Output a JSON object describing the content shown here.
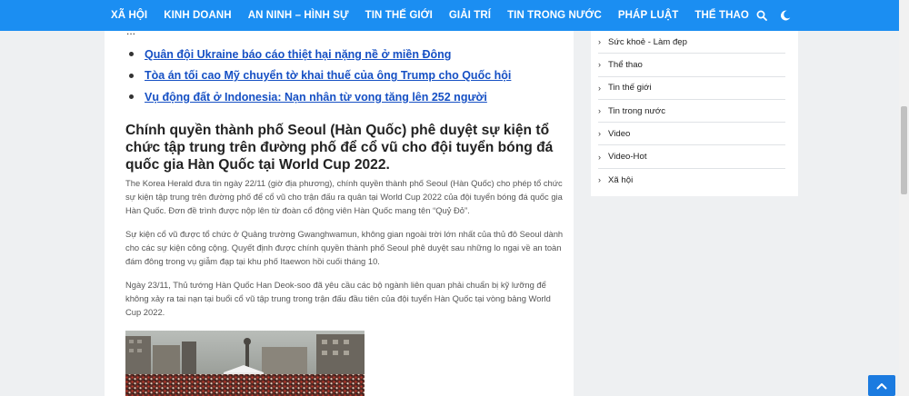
{
  "nav": {
    "items": [
      "Xã hội",
      "Kinh doanh",
      "An ninh – Hình sự",
      "Tin thế giới",
      "Giải trí",
      "Tin trong nước",
      "Pháp luật",
      "Thể thao"
    ],
    "icons": [
      "search-icon",
      "moon-icon"
    ]
  },
  "article": {
    "partial_line": "...",
    "related_links": [
      "Quân đội Ukraine báo cáo thiệt hại nặng nề ở miền Đông",
      "Tòa án tối cao Mỹ chuyển tờ khai thuế của ông Trump cho Quốc hội",
      "Vụ động đất ở Indonesia: Nạn nhân từ vong tăng lên 252 người"
    ],
    "headline": "Chính quyền thành phố Seoul (Hàn Quốc) phê duyệt sự kiện tổ chức tập trung trên đường phố để cổ vũ cho đội tuyển bóng đá quốc gia Hàn Quốc tại World Cup 2022.",
    "paragraphs": [
      "The Korea Herald đưa tin ngày 22/11 (giờ địa phương), chính quyền thành phố Seoul (Hàn Quốc) cho phép tổ chức sự kiện tập trung trên đường phố để cổ vũ cho trận đấu ra quân tại World Cup 2022 của đội tuyển bóng đá quốc gia Hàn Quốc. Đơn đề trình được nộp lên từ đoàn cổ động viên Hàn Quốc mang tên “Quỷ Đỏ”.",
      "Sự kiện cổ vũ được tổ chức ở Quảng trường Gwanghwamun, không gian ngoài trời lớn nhất của thủ đô Seoul dành cho các sự kiện công cộng. Quyết định được chính quyền thành phố Seoul phê duyệt sau những lo ngại về an toàn đám đông trong vụ giẫm đạp tại khu phố Itaewon hồi cuối tháng 10.",
      "Ngày 23/11, Thủ tướng Hàn Quốc Han Deok-soo đã yêu cầu các bộ ngành liên quan phải chuẩn bị kỹ lưỡng để không xảy ra tai nạn tại buổi cổ vũ tập trung trong trận đấu đầu tiên của đội tuyển Hàn Quốc tại vòng bảng World Cup 2022."
    ]
  },
  "sidebar": {
    "categories": [
      "Sức khoẻ - Làm đẹp",
      "Thể thao",
      "Tin thế giới",
      "Tin trong nước",
      "Video",
      "Video-Hot",
      "Xã hội"
    ]
  },
  "colors": {
    "nav_bg": "#1b8ef2",
    "link": "#1650c4",
    "page_bg": "#eef0f2"
  }
}
